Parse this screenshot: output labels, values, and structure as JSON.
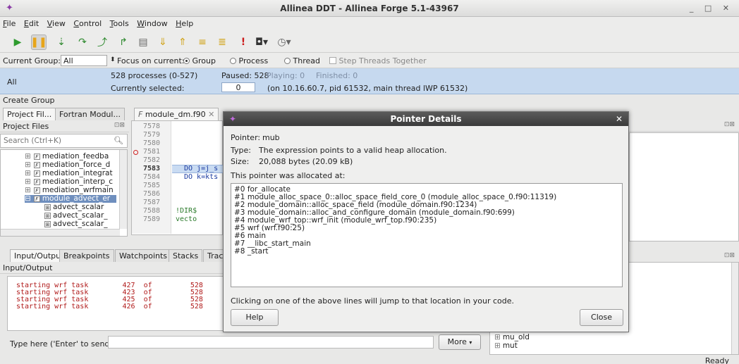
{
  "window": {
    "title": "Allinea DDT - Allinea Forge 5.1-43967",
    "controls": "_ □ ✕"
  },
  "menu": [
    "File",
    "Edit",
    "View",
    "Control",
    "Tools",
    "Window",
    "Help"
  ],
  "toolbar_icons": [
    "play-icon",
    "pause-icon",
    "step-into-icon",
    "step-over-icon",
    "step-out-icon",
    "run-to-line-icon",
    "down-frame-icon",
    "up-frame-icon",
    "align-stack-icon",
    "evaluate-icon",
    "breakpoint-icon",
    "camera-icon",
    "tracepoint-icon"
  ],
  "group_bar": {
    "current_group_label": "Current Group:",
    "current_group_value": "All",
    "focus_label": "Focus on current:",
    "group": "Group",
    "process": "Process",
    "thread": "Thread",
    "step_threads": "Step Threads Together"
  },
  "process_bar": {
    "group_name": "All",
    "processes": "528 processes (0-527)",
    "paused": "Paused: 528",
    "playing": "Playing: 0",
    "finished": "Finished: 0",
    "currently_selected_label": "Currently selected:",
    "currently_selected_value": "0",
    "selection_detail": "(on 10.16.60.7, pid 61532, main thread lWP 61532)"
  },
  "create_group": "Create Group",
  "left_panel": {
    "tabs": [
      "Project Fil...",
      "Fortran Modul..."
    ],
    "header": "Project Files",
    "search_placeholder": "Search (Ctrl+K)",
    "items": [
      "mediation_feedba",
      "mediation_force_d",
      "mediation_integrat",
      "mediation_interp_c",
      "mediation_wrfmain",
      "module_advect_er",
      "advect_scalar",
      "advect_scalar_",
      "advect_scalar_"
    ]
  },
  "editor": {
    "tab": "module_dm.f90",
    "line_numbers": [
      "7578",
      "7579",
      "7580",
      "7581",
      "7582",
      "7583",
      "7584",
      "7585",
      "7586",
      "7587",
      "7588",
      "7589"
    ],
    "code": {
      "l7583": "DO j=j_s",
      "l7584": "DO k=kts",
      "l7588": "!DIR$ vecto"
    }
  },
  "bottom_panel": {
    "tabs": [
      "Input/Output",
      "Breakpoints",
      "Watchpoints",
      "Stacks",
      "Trac"
    ],
    "header": "Input/Output",
    "output_lines": [
      "starting wrf task        427  of         528",
      "starting wrf task        423  of         528",
      "starting wrf task        425  of         528",
      "starting wrf task        426  of         528"
    ],
    "input_label": "Type here ('Enter' to send):",
    "more_button": "More"
  },
  "right_panel": {
    "vars": [
      "mu_old",
      "mut"
    ]
  },
  "status": "Ready",
  "dialog": {
    "title": "Pointer Details",
    "pointer_label": "Pointer:",
    "pointer_value": "mub",
    "type_label": "Type:",
    "type_value": "The expression points to a valid heap allocation.",
    "size_label": "Size:",
    "size_value": "20,088 bytes (20.09 kB)",
    "allocated_at": "This pointer was allocated at:",
    "stack": [
      "#0 for_allocate",
      "#1 module_alloc_space_0::alloc_space_field_core_0 (module_alloc_space_0.f90:11319)",
      "#2 module_domain::alloc_space_field (module_domain.f90:1234)",
      "#3 module_domain::alloc_and_configure_domain (module_domain.f90:699)",
      "#4 module_wrf_top::wrf_init (module_wrf_top.f90:235)",
      "#5 wrf (wrf.f90:25)",
      "#6 main",
      "#7 __libc_start_main",
      "#8 _start"
    ],
    "hint": "Clicking on one of the above lines will jump to that location in your code.",
    "help_button": "Help",
    "close_button": "Close"
  }
}
